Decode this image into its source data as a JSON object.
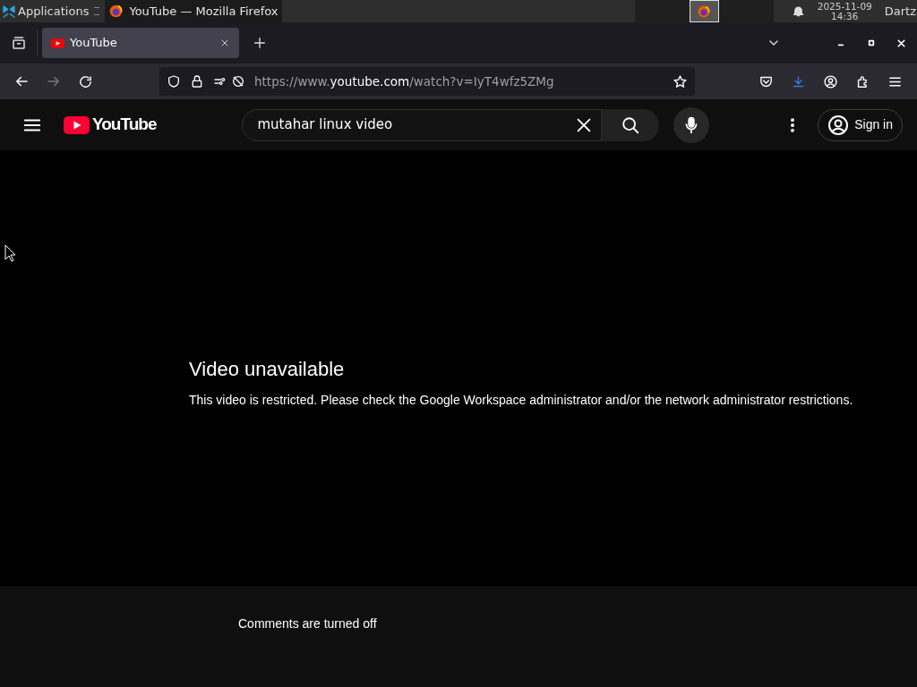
{
  "panel": {
    "apps_label": "Applications",
    "window_button": "YouTube — Mozilla Firefox",
    "clock_date": "2025-11-09",
    "clock_time": "14:36",
    "user": "Dartz"
  },
  "tabs": [
    {
      "label": "YouTube",
      "selected": true
    }
  ],
  "url": {
    "scheme": "https://www.",
    "host": "youtube.com",
    "path": "/watch?v=IyT4wfz5ZMg"
  },
  "youtube": {
    "logo": "YouTube",
    "search_value": "mutahar linux video",
    "sign_in": "Sign in"
  },
  "video": {
    "title": "Video unavailable",
    "message": "This video is restricted. Please check the Google Workspace administrator and/or the network administrator restrictions."
  },
  "comments": "Comments are turned off"
}
